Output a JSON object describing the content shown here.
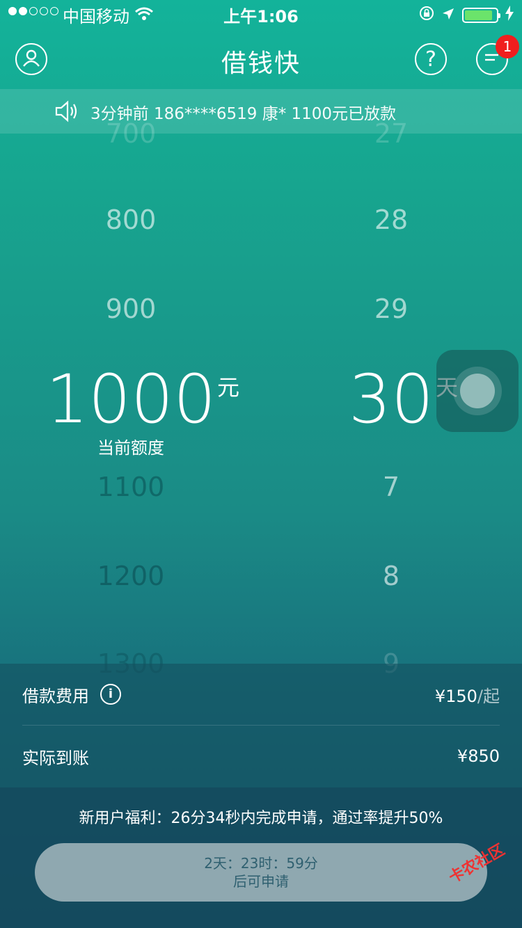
{
  "status_bar": {
    "carrier": "中国移动",
    "time": "上午1:06"
  },
  "header": {
    "title": "借钱快",
    "help_glyph": "?",
    "badge_count": "1"
  },
  "notice": {
    "text": "3分钟前 186****6519 康* 1100元已放款"
  },
  "amount_picker": {
    "items": [
      "700",
      "800",
      "900",
      "1000",
      "1100",
      "1200",
      "1300"
    ],
    "selected": "1000",
    "unit": "元",
    "caption": "当前额度"
  },
  "days_picker": {
    "items": [
      "27",
      "28",
      "29",
      "30",
      "7",
      "8",
      "9"
    ],
    "selected": "30",
    "unit": "天"
  },
  "fee": {
    "label": "借款费用",
    "info_glyph": "i",
    "value": "¥150",
    "suffix": "/起"
  },
  "net": {
    "label": "实际到账",
    "value": "¥850"
  },
  "bonus_text": "新用户福利：26分34秒内完成申请，通过率提升50%",
  "apply": {
    "line1": "2天：23时：59分",
    "line2": "后可申请"
  },
  "watermark": "卡农社区",
  "colors": {
    "accent_top": "#13b39a",
    "accent_bottom": "#175a6c",
    "badge": "#f01e1e"
  }
}
